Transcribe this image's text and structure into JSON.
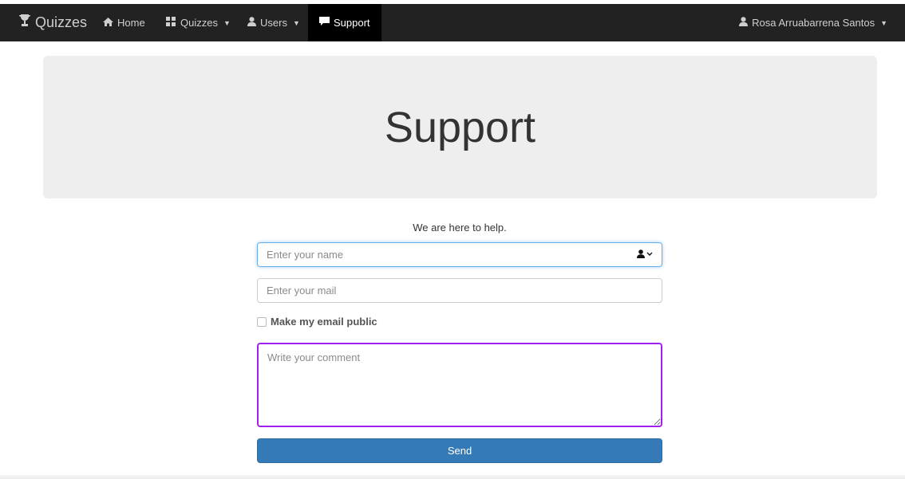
{
  "navbar": {
    "brand": "Quizzes",
    "home": "Home",
    "quizzes": "Quizzes",
    "users": "Users",
    "support": "Support",
    "user_name": "Rosa Arruabarrena Santos"
  },
  "page": {
    "title": "Support",
    "subtitle": "We are here to help."
  },
  "form": {
    "name_placeholder": "Enter your name",
    "mail_placeholder": "Enter your mail",
    "public_label": "Make my email public",
    "comment_placeholder": "Write your comment",
    "send_label": "Send"
  },
  "icons": {
    "brand": "trophy-icon",
    "home": "home-icon",
    "quizzes": "quizzes-icon",
    "users": "user-icon",
    "support": "comment-icon",
    "account": "user-icon"
  },
  "colors": {
    "navbar_bg": "#222222",
    "active_nav_bg": "#000000",
    "jumbotron_bg": "#eeeeee",
    "primary_button": "#337ab7",
    "focus_border": "#66afe9",
    "textarea_border": "#a020f0"
  }
}
